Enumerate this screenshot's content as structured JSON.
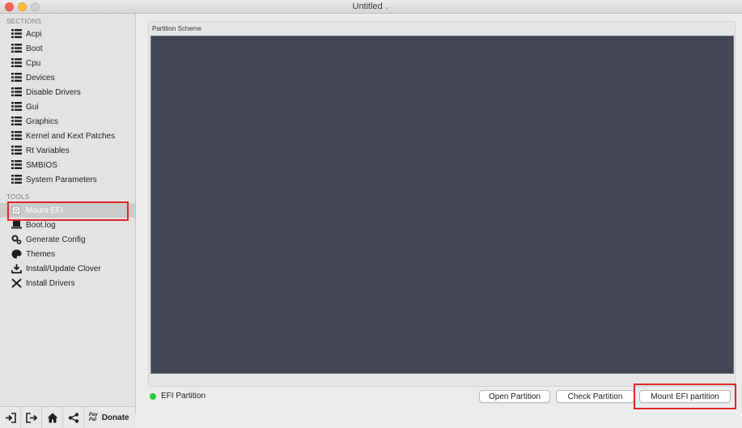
{
  "window": {
    "title": "Untitled"
  },
  "sidebar": {
    "sections_header": "SECTIONS",
    "sections": [
      {
        "label": "Acpi",
        "icon": "list-icon"
      },
      {
        "label": "Boot",
        "icon": "list-icon"
      },
      {
        "label": "Cpu",
        "icon": "list-icon"
      },
      {
        "label": "Devices",
        "icon": "list-icon"
      },
      {
        "label": "Disable Drivers",
        "icon": "list-icon"
      },
      {
        "label": "Gui",
        "icon": "list-icon"
      },
      {
        "label": "Graphics",
        "icon": "list-icon"
      },
      {
        "label": "Kernel and Kext Patches",
        "icon": "list-icon"
      },
      {
        "label": "Rt Variables",
        "icon": "list-icon"
      },
      {
        "label": "SMBIOS",
        "icon": "list-icon"
      },
      {
        "label": "System Parameters",
        "icon": "list-icon"
      }
    ],
    "tools_header": "TOOLS",
    "tools": [
      {
        "label": "Mount EFI",
        "icon": "mount-icon",
        "selected": true
      },
      {
        "label": "Boot.log",
        "icon": "laptop-icon"
      },
      {
        "label": "Generate Config",
        "icon": "gears-icon"
      },
      {
        "label": "Themes",
        "icon": "palette-icon"
      },
      {
        "label": "Install/Update Clover",
        "icon": "download-icon"
      },
      {
        "label": "Install Drivers",
        "icon": "tools-icon"
      }
    ],
    "bottom": {
      "buttons": [
        "import-icon",
        "export-icon",
        "home-icon",
        "share-icon"
      ],
      "paypal_top": "Pay",
      "paypal_bottom": "Pal",
      "donate_label": "Donate"
    }
  },
  "main": {
    "group_label": "Partition Scheme",
    "status_label": "EFI Partition",
    "status_color": "#27c93f",
    "buttons": {
      "open": "Open Partition",
      "check": "Check Partition",
      "mount": "Mount EFI partition"
    }
  },
  "colors": {
    "scheme_bg": "#434654",
    "highlight": "#e02727"
  }
}
